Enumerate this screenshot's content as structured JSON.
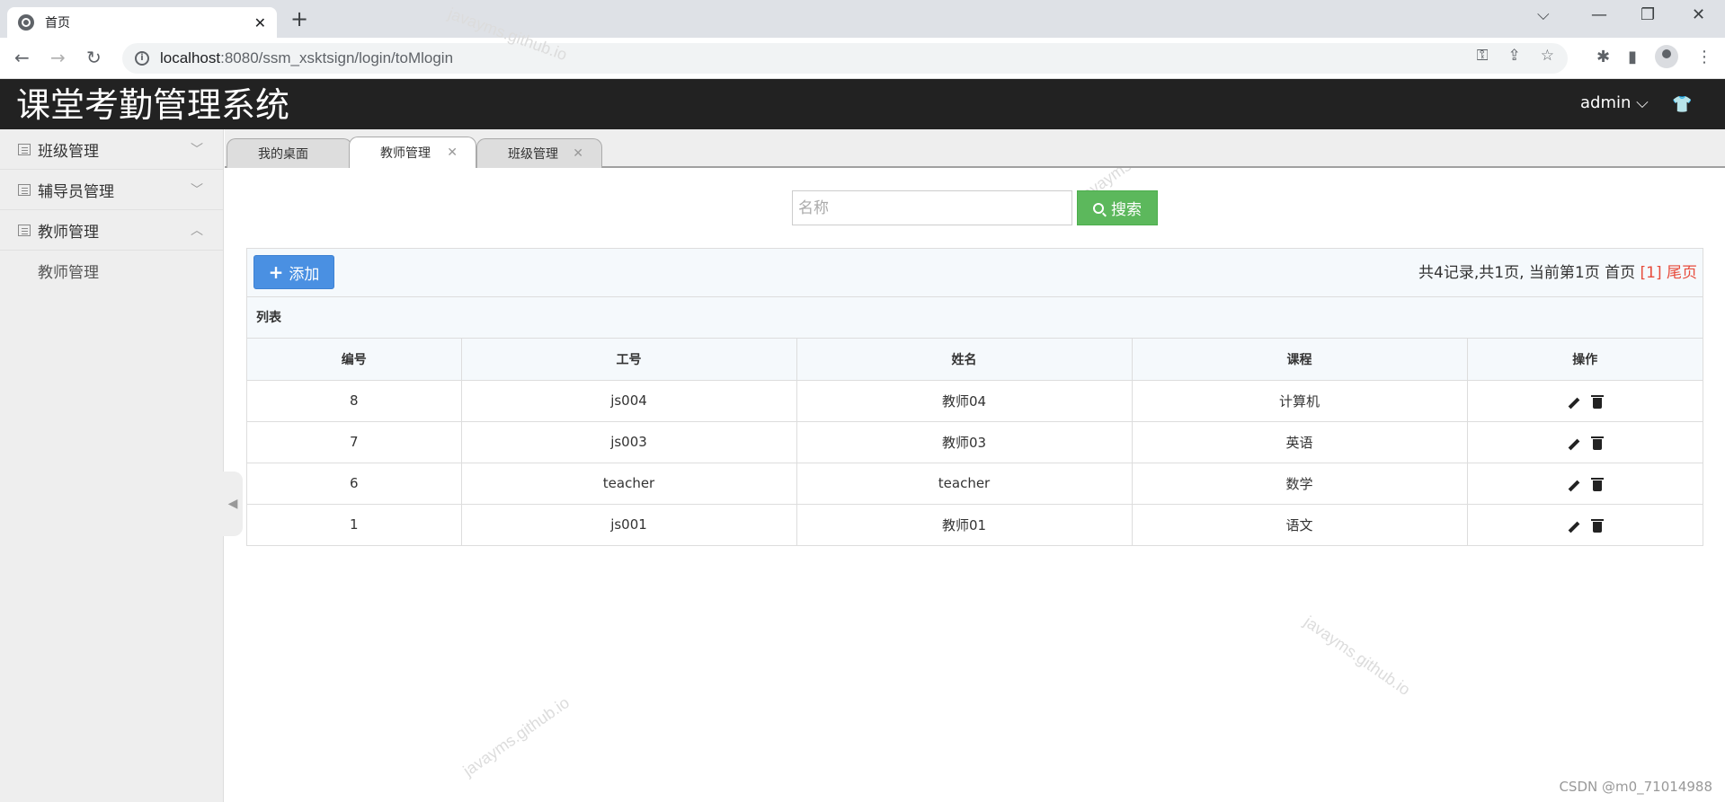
{
  "browser": {
    "tab_title": "首页",
    "url_host": "localhost",
    "url_rest": ":8080/ssm_xsktsign/login/toMlogin",
    "new_tab_glyph": "+",
    "close_glyph": "✕"
  },
  "app": {
    "title": "课堂考勤管理系统",
    "user": "admin"
  },
  "sidebar": {
    "items": [
      {
        "label": "班级管理"
      },
      {
        "label": "辅导员管理"
      },
      {
        "label": "教师管理"
      }
    ],
    "submenu": [
      {
        "label": "教师管理"
      }
    ]
  },
  "content_tabs": [
    {
      "label": "我的桌面"
    },
    {
      "label": "教师管理"
    },
    {
      "label": "班级管理"
    }
  ],
  "search": {
    "placeholder": "名称",
    "button_label": "搜索"
  },
  "panel": {
    "add_label": "添加",
    "pager_text": "共4记录,共1页, 当前第1页 首页 ",
    "pager_current": "[1]",
    "pager_last": " 尾页",
    "list_title": "列表"
  },
  "table": {
    "headers": [
      "编号",
      "工号",
      "姓名",
      "课程",
      "操作"
    ],
    "rows": [
      [
        "8",
        "js004",
        "教师04",
        "计算机"
      ],
      [
        "7",
        "js003",
        "教师03",
        "英语"
      ],
      [
        "6",
        "teacher",
        "teacher",
        "数学"
      ],
      [
        "1",
        "js001",
        "教师01",
        "语文"
      ]
    ]
  },
  "watermark": "javayms.github.io",
  "credit": "CSDN @m0_71014988"
}
